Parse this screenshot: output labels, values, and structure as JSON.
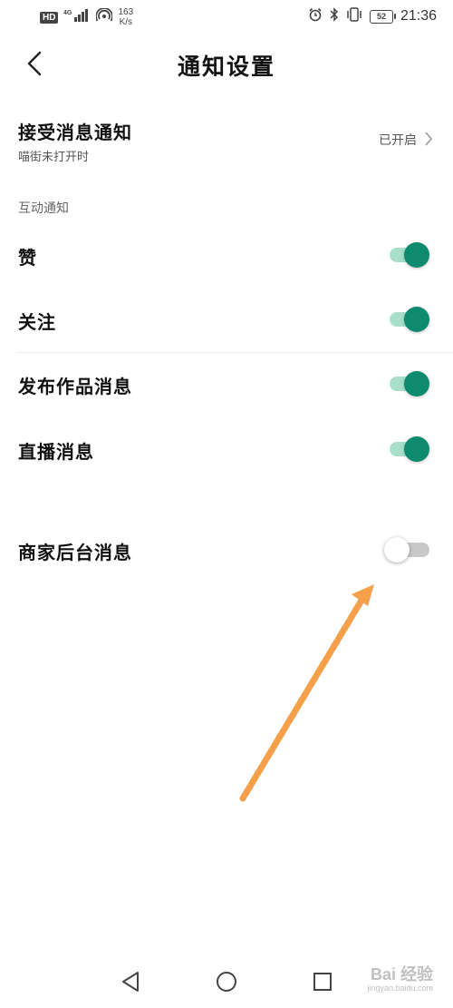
{
  "status_bar": {
    "hd_badge": "HD",
    "network_type": "4G",
    "net_speed_value": "163",
    "net_speed_unit": "K/s",
    "battery_level": "52",
    "time": "21:36",
    "icons": [
      "signal-icon",
      "wifi-hotspot-icon",
      "alarm-icon",
      "bluetooth-icon",
      "vibrate-icon",
      "battery-icon"
    ]
  },
  "header": {
    "title": "通知设置",
    "back_icon": "chevron-left-icon"
  },
  "receive_notifications": {
    "label": "接受消息通知",
    "subtitle": "喵街未打开时",
    "value": "已开启"
  },
  "section": {
    "title": "互动通知"
  },
  "toggles": [
    {
      "label": "赞",
      "state": "on"
    },
    {
      "label": "关注",
      "state": "on"
    },
    {
      "label": "发布作品消息",
      "state": "on"
    },
    {
      "label": "直播消息",
      "state": "on"
    },
    {
      "label": "商家后台消息",
      "state": "off"
    }
  ],
  "colors": {
    "toggle_on": "#0e8a6e",
    "toggle_on_track": "#a8dfc9",
    "toggle_off_track": "#c8c8c8",
    "annotation_arrow": "#f5a04a"
  },
  "nav_bar": {
    "icons": [
      "nav-back-icon",
      "nav-home-icon",
      "nav-recents-icon"
    ]
  },
  "watermark": {
    "text": "Bai 经验",
    "sub": "jingyan.baidu.com"
  }
}
